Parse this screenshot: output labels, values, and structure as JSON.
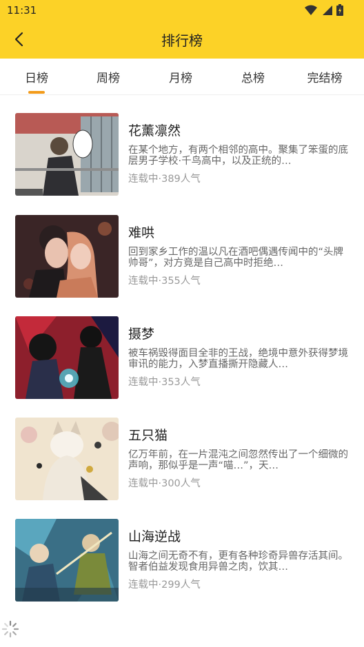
{
  "status_bar": {
    "time": "11:31"
  },
  "header": {
    "title": "排行榜"
  },
  "tabs": [
    {
      "label": "日榜",
      "active": true
    },
    {
      "label": "周榜"
    },
    {
      "label": "月榜"
    },
    {
      "label": "总榜"
    },
    {
      "label": "完结榜"
    }
  ],
  "items": [
    {
      "title": "花薰凛然",
      "desc": "在某个地方，有两个相邻的高中。聚集了笨蛋的底层男子学校·千鸟高中，以及正统的…",
      "meta": "连载中·389人气"
    },
    {
      "title": "难哄",
      "desc": "回到家乡工作的温以凡在酒吧偶遇传闻中的“头牌帅哥”，对方竟是自己高中时拒绝…",
      "meta": "连载中·355人气"
    },
    {
      "title": "摄梦",
      "desc": "被车祸毁得面目全非的王战，绝境中意外获得梦境审讯的能力，入梦直播撕开隐藏人…",
      "meta": "连载中·353人气"
    },
    {
      "title": "五只猫",
      "desc": "亿万年前，在一片混沌之间忽然传出了一个细微的声响，那似乎是一声“喵…”，天…",
      "meta": "连载中·300人气"
    },
    {
      "title": "山海逆战",
      "desc": "山海之间无奇不有，更有各种珍奇异兽存活其间。智者伯益发现食用异兽之肉，饮其…",
      "meta": "连载中·299人气"
    }
  ],
  "colors": {
    "accent": "#FCD227",
    "indicator": "#F29B1B"
  }
}
